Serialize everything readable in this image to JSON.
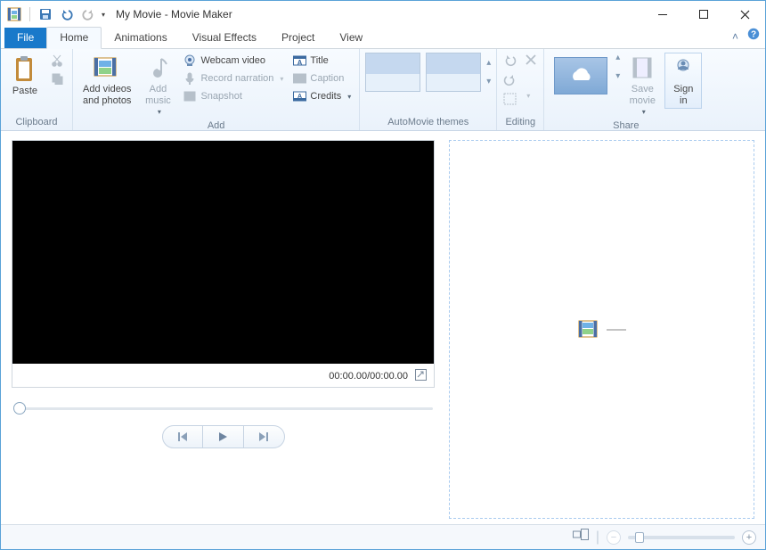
{
  "window": {
    "title": "My Movie - Movie Maker"
  },
  "tabs": {
    "file": "File",
    "items": [
      "Home",
      "Animations",
      "Visual Effects",
      "Project",
      "View"
    ],
    "active_index": 0
  },
  "ribbon": {
    "clipboard": {
      "label": "Clipboard",
      "paste": "Paste"
    },
    "add": {
      "label": "Add",
      "add_videos": "Add videos\nand photos",
      "add_music": "Add\nmusic",
      "webcam": "Webcam video",
      "narration": "Record narration",
      "snapshot": "Snapshot",
      "title": "Title",
      "caption": "Caption",
      "credits": "Credits"
    },
    "automovie": {
      "label": "AutoMovie themes"
    },
    "editing": {
      "label": "Editing"
    },
    "share": {
      "label": "Share",
      "save_movie": "Save\nmovie",
      "sign_in": "Sign\nin"
    }
  },
  "player": {
    "time": "00:00.00/00:00.00"
  }
}
